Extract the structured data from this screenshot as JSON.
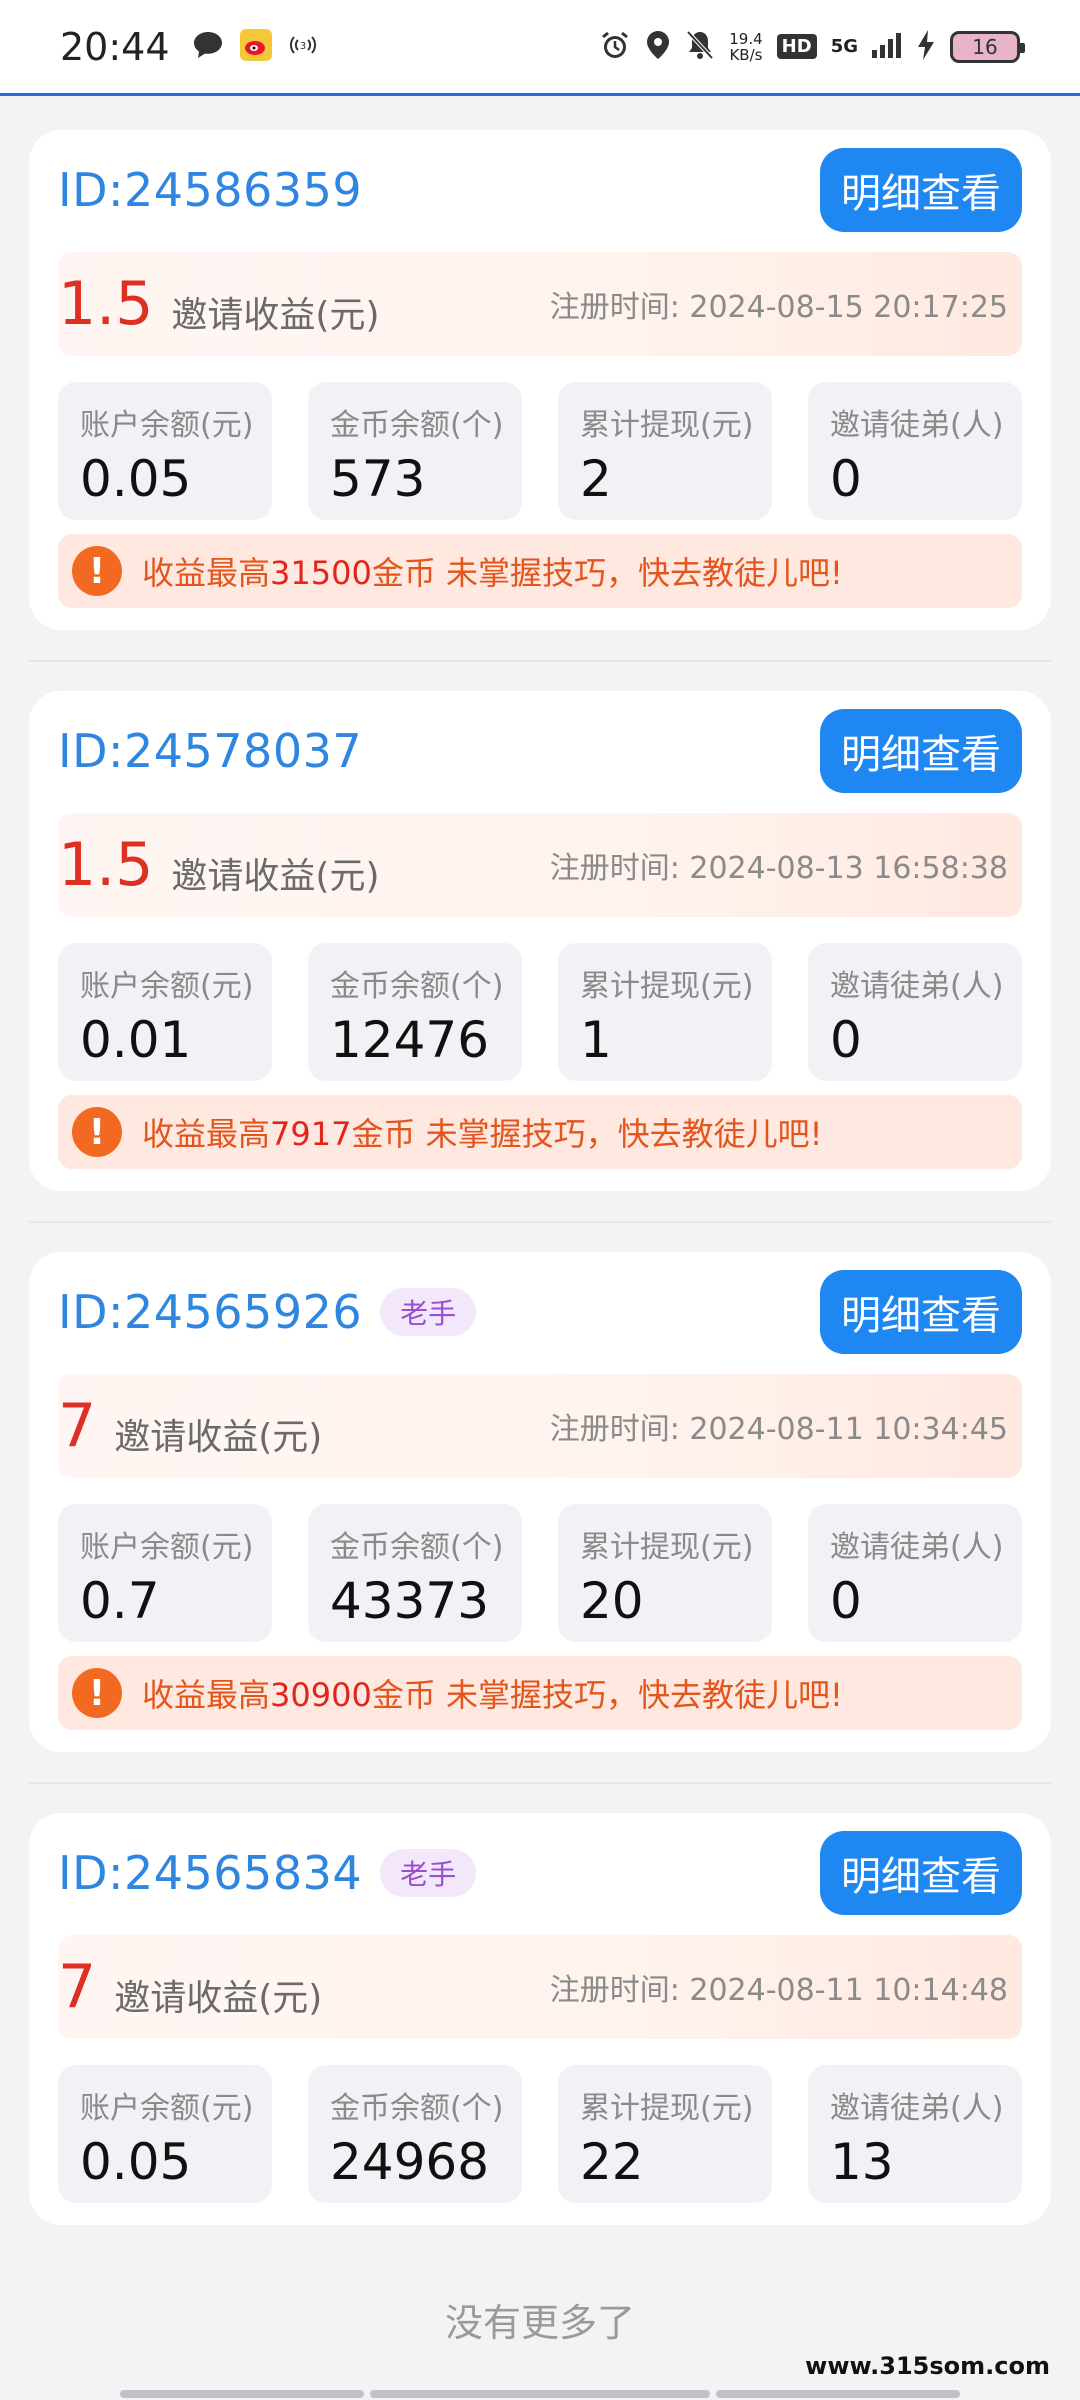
{
  "status_bar": {
    "time": "20:44",
    "net_speed_value": "19.4",
    "net_speed_unit": "KB/s",
    "hd_label": "HD",
    "network": "5G",
    "battery": "16"
  },
  "detail_button_label": "明细查看",
  "labels": {
    "earn": "邀请收益(元)",
    "reg_prefix": "注册时间: ",
    "stat_balance": "账户余额(元)",
    "stat_coins": "金币余额(个)",
    "stat_withdraw": "累计提现(元)",
    "stat_invites": "邀请徒弟(人)",
    "tip_before": "收益最高",
    "tip_after": "金币 未掌握技巧，快去教徒儿吧!",
    "veteran_tag": "老手"
  },
  "cards": [
    {
      "id": "ID:24586359",
      "earning": "1.5",
      "reg_time": "2024-08-15 20:17:25",
      "balance": "0.05",
      "coins": "573",
      "withdrawn": "2",
      "invites": "0",
      "tip_max": "31500"
    },
    {
      "id": "ID:24578037",
      "earning": "1.5",
      "reg_time": "2024-08-13 16:58:38",
      "balance": "0.01",
      "coins": "12476",
      "withdrawn": "1",
      "invites": "0",
      "tip_max": "7917"
    },
    {
      "id": "ID:24565926",
      "earning": "7",
      "reg_time": "2024-08-11 10:34:45",
      "balance": "0.7",
      "coins": "43373",
      "withdrawn": "20",
      "invites": "0",
      "tip_max": "30900"
    },
    {
      "id": "ID:24565834",
      "earning": "7",
      "reg_time": "2024-08-11 10:14:48",
      "balance": "0.05",
      "coins": "24968",
      "withdrawn": "22",
      "invites": "13"
    }
  ],
  "footer_text": "没有更多了",
  "watermark": "www.315som.com",
  "colors": {
    "primary_blue": "#1f87f2",
    "id_blue": "#2f86e0",
    "earning_red": "#dd3025",
    "tip_orange": "#e2561e",
    "veteran_purple": "#9a4fd0"
  }
}
